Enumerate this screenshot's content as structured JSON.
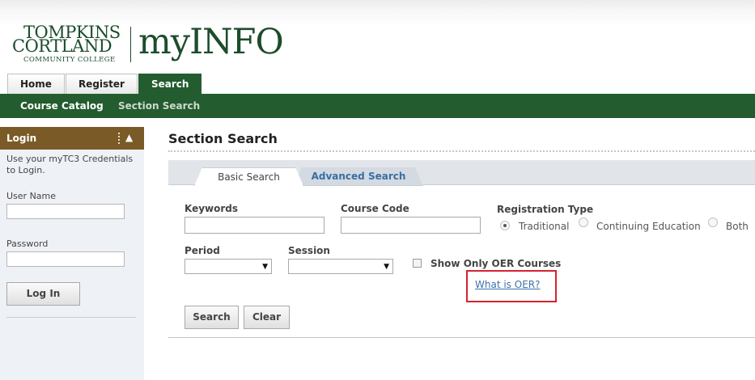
{
  "header": {
    "logo": {
      "line1": "TOMPKINS",
      "line2": "CORTLAND",
      "line3": "COMMUNITY COLLEGE"
    },
    "app_title": "myINFO",
    "colors": {
      "brand_green": "#235c2f",
      "sidebar_header": "#7a5a26",
      "link": "#3b72a8",
      "highlight": "#d3242f"
    }
  },
  "nav": {
    "tabs": [
      {
        "label": "Home",
        "active": false
      },
      {
        "label": "Register",
        "active": false
      },
      {
        "label": "Search",
        "active": true
      }
    ],
    "subnav": [
      {
        "label": "Course Catalog",
        "active": true
      },
      {
        "label": "Section Search",
        "active": false
      }
    ]
  },
  "sidebar": {
    "title": "Login",
    "collapse_icon": "triangle-up-icon",
    "description": "Use your myTC3 Credentials to Login.",
    "username_label": "User Name",
    "username_value": "",
    "password_label": "Password",
    "password_value": "",
    "login_button": "Log In"
  },
  "main": {
    "title": "Section Search",
    "tabs": [
      {
        "label": "Basic Search",
        "active": true
      },
      {
        "label": "Advanced Search",
        "active": false
      }
    ],
    "form": {
      "keywords_label": "Keywords",
      "keywords_value": "",
      "course_code_label": "Course Code",
      "course_code_value": "",
      "registration_type_label": "Registration Type",
      "registration_options": [
        {
          "label": "Traditional",
          "selected": true
        },
        {
          "label": "Continuing Education",
          "selected": false
        },
        {
          "label": "Both",
          "selected": false
        }
      ],
      "period_label": "Period",
      "period_value": "",
      "session_label": "Session",
      "session_value": "",
      "oer_checkbox_label": "Show Only OER Courses",
      "oer_checked": false,
      "oer_link": "What is OER?",
      "search_button": "Search",
      "clear_button": "Clear"
    }
  }
}
